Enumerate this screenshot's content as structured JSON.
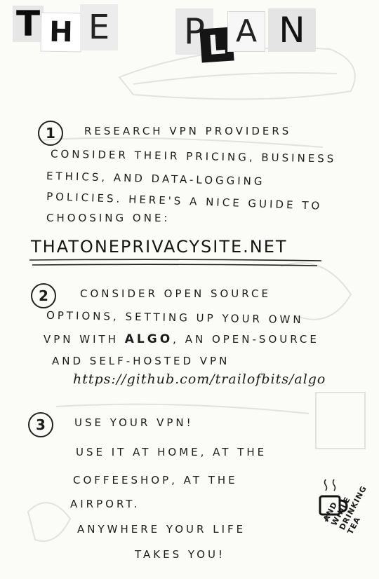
{
  "title_letters": [
    "T",
    "H",
    "E",
    "P",
    "L",
    "A",
    "N"
  ],
  "step1": {
    "number": "1",
    "lines": [
      "RESEARCH VPN PROVIDERS",
      "CONSIDER THEIR PRICING, BUSINESS",
      "ETHICS, AND DATA-LOGGING",
      "POLICIES. HERE'S A NICE GUIDE TO",
      "CHOOSING ONE:"
    ],
    "link": "THATONEPRIVACYSITE.NET"
  },
  "step2": {
    "number": "2",
    "line1": "CONSIDER OPEN SOURCE",
    "line2": "OPTIONS, SETTING UP YOUR OWN",
    "line3_before": "VPN WITH ",
    "line3_bold": "ALGO",
    "line3_after": ", AN OPEN-SOURCE",
    "line4": "AND SELF-HOSTED VPN",
    "url": "https://github.com/trailofbits/algo"
  },
  "step3": {
    "number": "3",
    "lines": [
      "USE YOUR VPN!",
      "USE IT AT HOME, AT THE",
      "COFFEESHOP, AT THE",
      "AIRPORT.",
      "ANYWHERE YOUR LIFE",
      "TAKES YOU!"
    ]
  },
  "tea_note": "AND\nWHILE\nDRINKING\nTEA",
  "colors": {
    "ink": "#1c1c1c",
    "paper": "#fbfbf8",
    "bleed": "#e2e2dc"
  },
  "icons": [
    "tea-mug-icon"
  ]
}
